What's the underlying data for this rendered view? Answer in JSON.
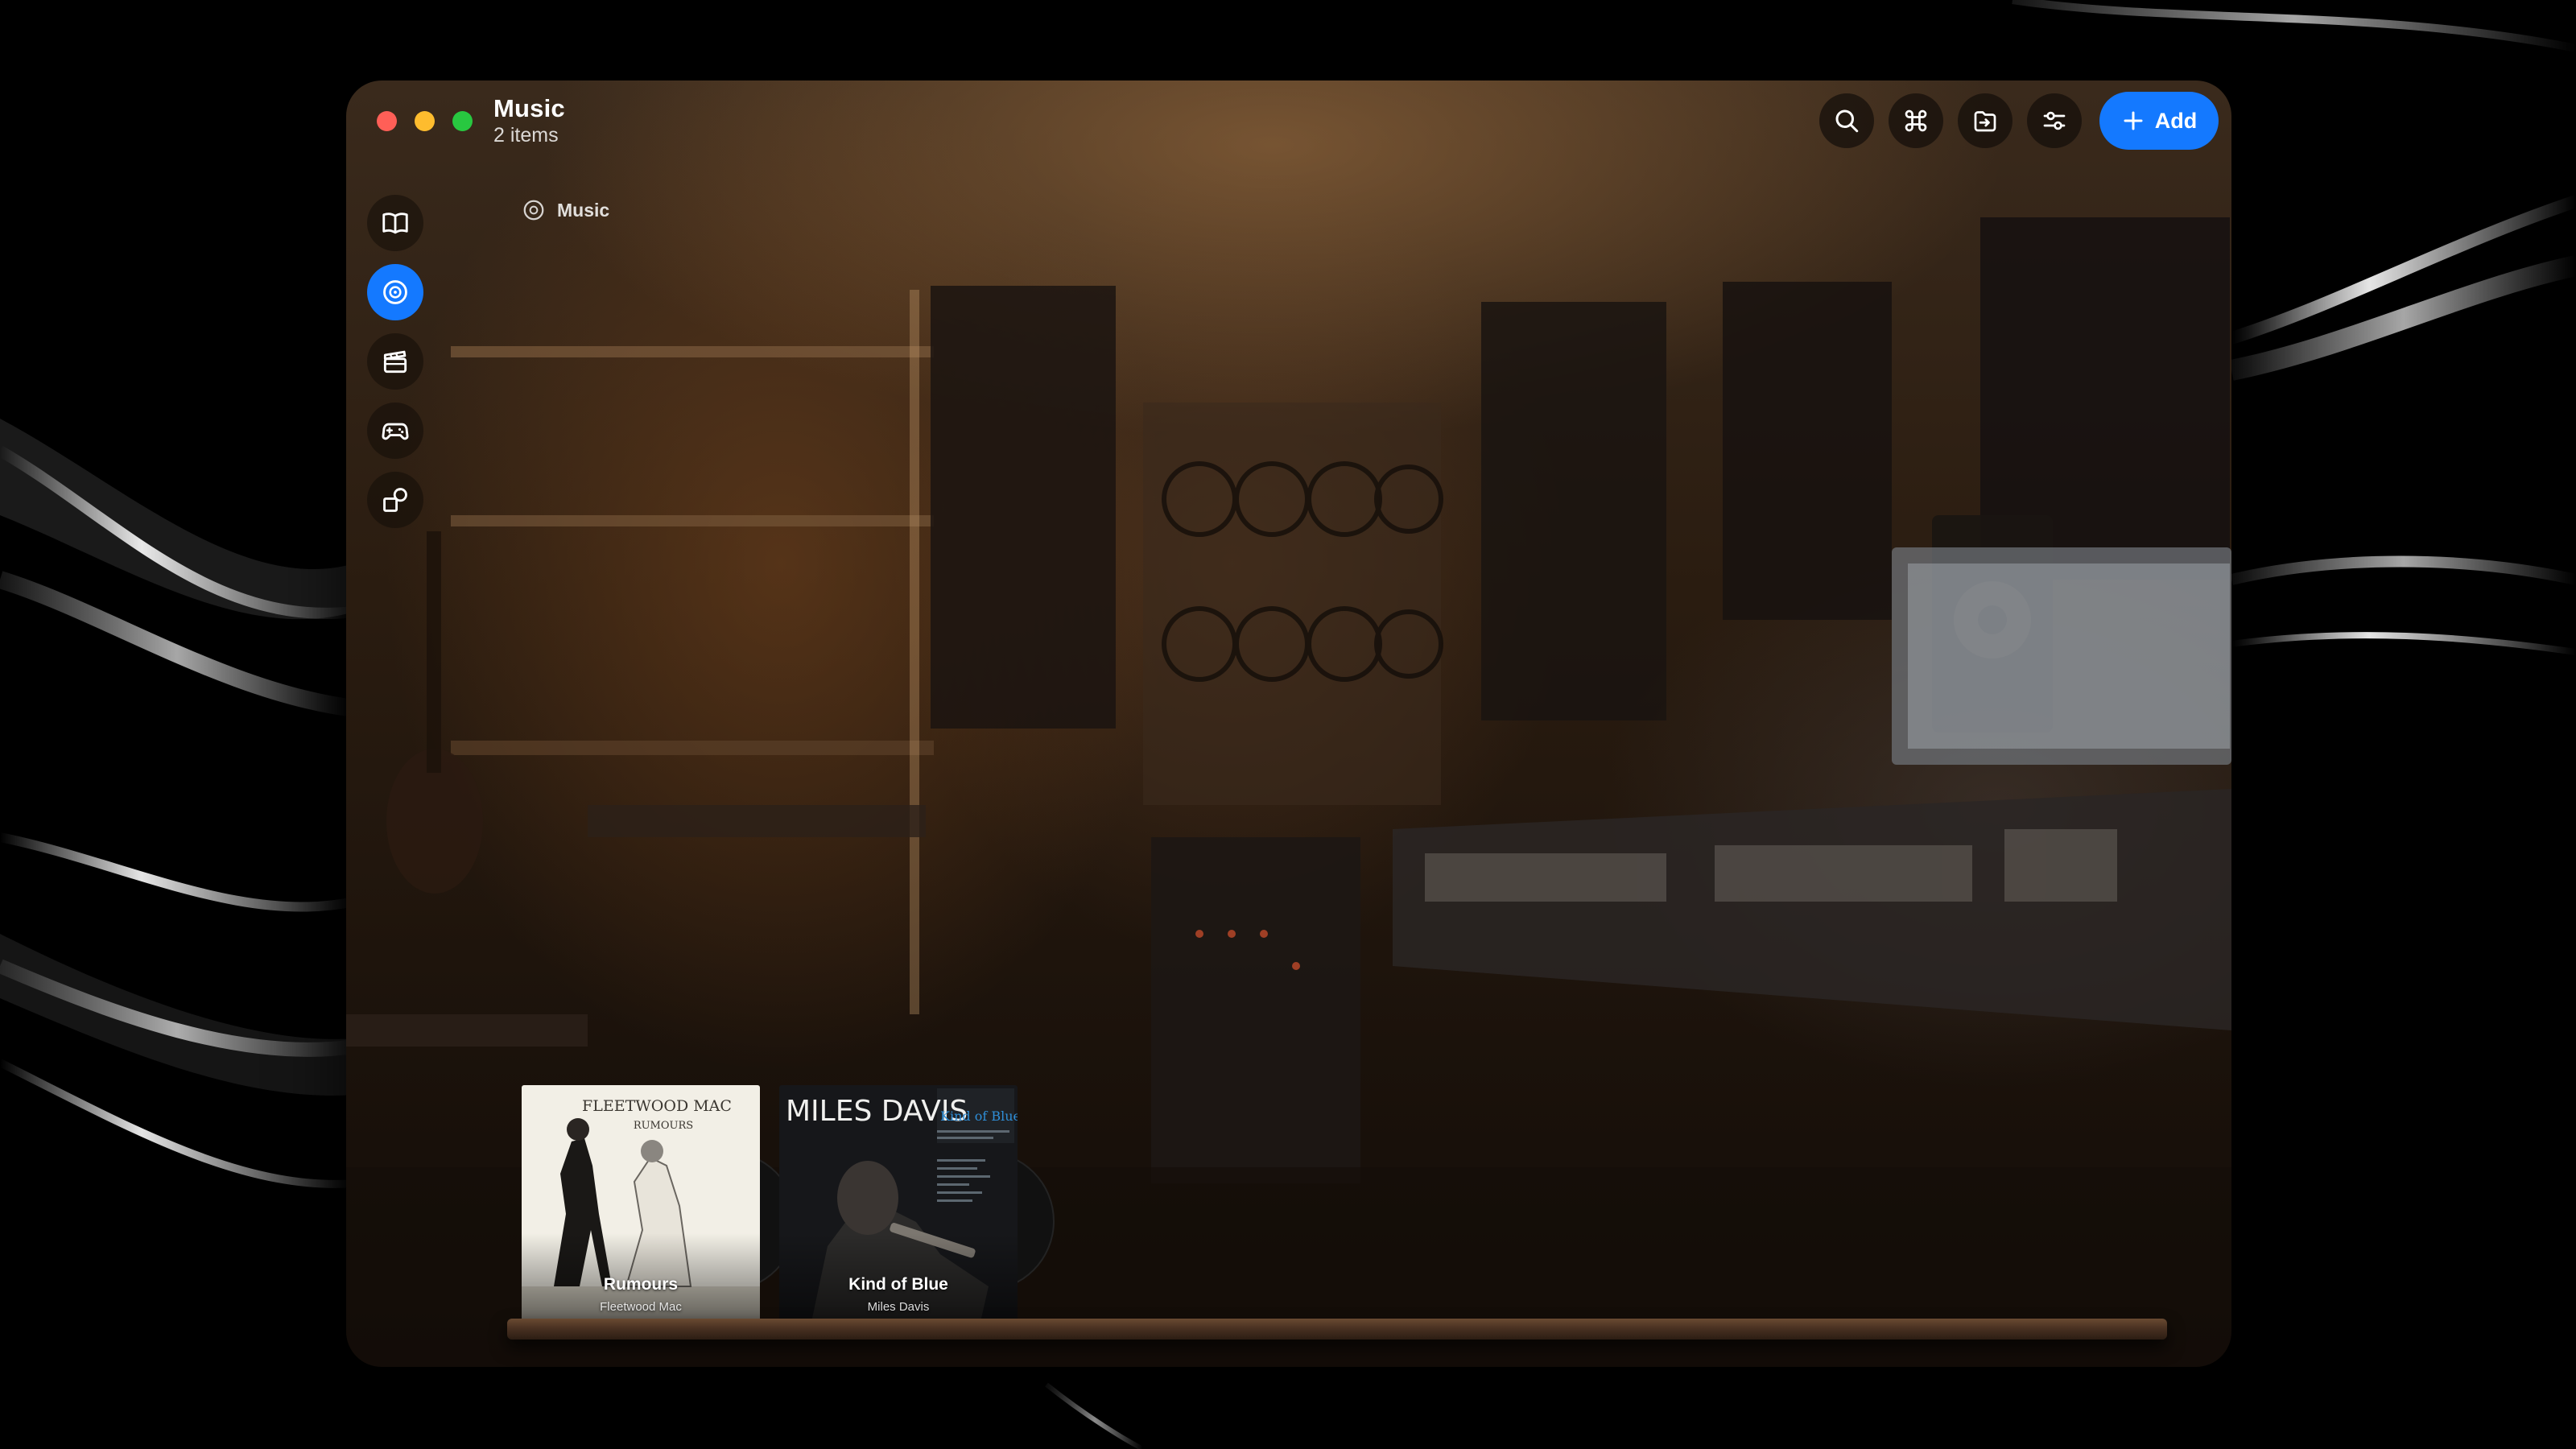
{
  "window": {
    "title": "Music",
    "subtitle": "2 items"
  },
  "toolbar": {
    "buttons": [
      {
        "icon": "search-icon"
      },
      {
        "icon": "command-icon"
      },
      {
        "icon": "import-icon"
      },
      {
        "icon": "filters-icon"
      }
    ],
    "add_label": "Add",
    "accent": "#1479ff"
  },
  "sidebar": {
    "items": [
      {
        "icon": "book-icon",
        "active": false
      },
      {
        "icon": "music-disc-icon",
        "active": true
      },
      {
        "icon": "clapperboard-icon",
        "active": false
      },
      {
        "icon": "gamepad-icon",
        "active": false
      },
      {
        "icon": "shapes-icon",
        "active": false
      }
    ]
  },
  "breadcrumb": {
    "label": "Music"
  },
  "albums": [
    {
      "title": "Rumours",
      "artist": "Fleetwood Mac",
      "cover_text": "FLEETWOOD MAC",
      "cover_subtext": "RUMOURS"
    },
    {
      "title": "Kind of Blue",
      "artist": "Miles Davis",
      "cover_text": "MILES DAVIS",
      "cover_subtext": "Kind of Blue"
    }
  ]
}
